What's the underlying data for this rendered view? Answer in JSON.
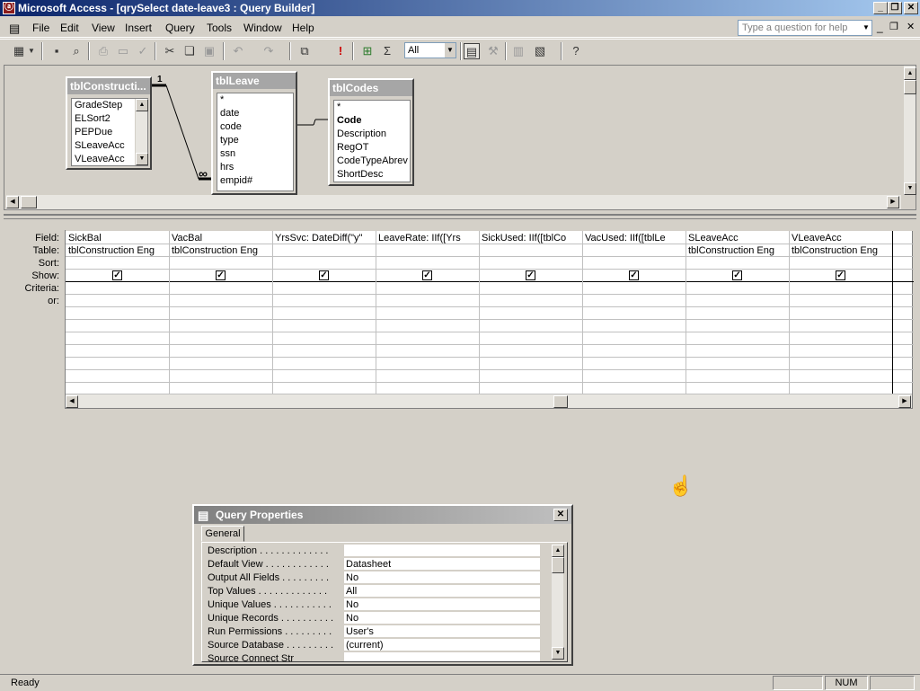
{
  "window": {
    "title": "Microsoft Access - [qrySelect date-leave3 : Query Builder]"
  },
  "menubar": {
    "items": [
      "File",
      "Edit",
      "View",
      "Insert",
      "Query",
      "Tools",
      "Window",
      "Help"
    ],
    "help_placeholder": "Type a question for help"
  },
  "toolbar": {
    "top_values": "All"
  },
  "tables": {
    "t1": {
      "title": "tblConstructi...",
      "fields": [
        "GradeStep",
        "ELSort2",
        "PEPDue",
        "SLeaveAcc",
        "VLeaveAcc"
      ]
    },
    "t2": {
      "title": "tblLeave",
      "fields": [
        "*",
        "date",
        "code",
        "type",
        "ssn",
        "hrs",
        "empid#"
      ]
    },
    "t3": {
      "title": "tblCodes",
      "fields": [
        "*",
        "Code",
        "Description",
        "RegOT",
        "CodeTypeAbrev",
        "ShortDesc"
      ]
    },
    "relation": {
      "one": "1",
      "many": "∞"
    }
  },
  "grid": {
    "row_labels": [
      "Field:",
      "Table:",
      "Sort:",
      "Show:",
      "Criteria:",
      "or:"
    ],
    "columns": [
      {
        "field": "SickBal",
        "table": "tblConstruction Eng",
        "show": true
      },
      {
        "field": "VacBal",
        "table": "tblConstruction Eng",
        "show": true
      },
      {
        "field": "YrsSvc: DateDiff(\"y\"",
        "table": "",
        "show": true
      },
      {
        "field": "LeaveRate: IIf([Yrs",
        "table": "",
        "show": true
      },
      {
        "field": "SickUsed: IIf([tblCo",
        "table": "",
        "show": true
      },
      {
        "field": "VacUsed: IIf([tblLe",
        "table": "",
        "show": true
      },
      {
        "field": "SLeaveAcc",
        "table": "tblConstruction Eng",
        "show": true
      },
      {
        "field": "VLeaveAcc",
        "table": "tblConstruction Eng",
        "show": true
      }
    ]
  },
  "properties": {
    "title": "Query Properties",
    "tab": "General",
    "rows": [
      {
        "label": "Description . . . . . . . . . . . . .",
        "value": ""
      },
      {
        "label": "Default View . . . . . . . . . . . .",
        "value": "Datasheet"
      },
      {
        "label": "Output All Fields . . . . . . . . .",
        "value": "No"
      },
      {
        "label": "Top Values . . . . . . . . . . . . .",
        "value": "All"
      },
      {
        "label": "Unique Values . . . . . . . . . . .",
        "value": "No"
      },
      {
        "label": "Unique Records . . . . . . . . . .",
        "value": "No"
      },
      {
        "label": "Run Permissions . . . . . . . . .",
        "value": "User's"
      },
      {
        "label": "Source Database . . . . . . . . .",
        "value": "(current)"
      },
      {
        "label": "Source Connect Str",
        "value": ""
      }
    ]
  },
  "statusbar": {
    "text": "Ready",
    "num": "NUM"
  }
}
